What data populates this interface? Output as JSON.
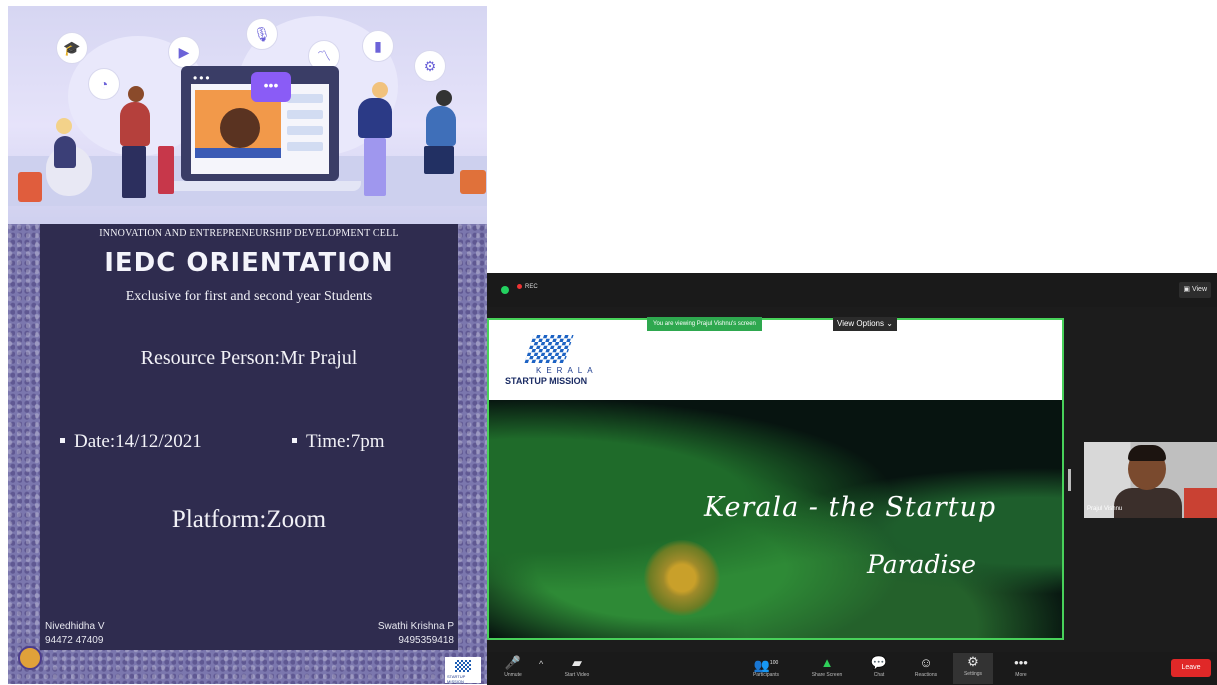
{
  "poster": {
    "header": "INNOVATION AND ENTREPRENEURSHIP DEVELOPMENT CELL",
    "title": "IEDC ORIENTATION",
    "subtitle": "Exclusive for first and second year Students",
    "resource_person": "Resource Person:Mr Prajul",
    "date": "Date:14/12/2021",
    "time": "Time:7pm",
    "platform": "Platform:Zoom",
    "contact_left_name": "Nivedhidha V",
    "contact_left_phone": "94472 47409",
    "contact_right_name": "Swathi Krishna P",
    "contact_right_phone": "9495359418",
    "illustration_icons": [
      "graduation-cap-icon",
      "pie-chart-icon",
      "video-camera-icon",
      "microphone-icon",
      "line-chart-icon",
      "books-icon",
      "gear-icon"
    ]
  },
  "zoom": {
    "recording_label": "REC",
    "view_label": "View",
    "banner": "You are viewing Prajul Vishnu's screen",
    "view_options": "View Options",
    "shared": {
      "kerala": "KERALA",
      "mission": "STARTUP MISSION",
      "script_line1": "Kerala - the Startup",
      "script_line2": "Paradise"
    },
    "participant_name": "Prajul Vishnu",
    "toolbar": {
      "unmute": "Unmute",
      "start_video": "Start Video",
      "participants": "Participants",
      "participants_count": "100",
      "share_screen": "Share Screen",
      "chat": "Chat",
      "reactions": "Reactions",
      "settings": "Settings",
      "more": "More",
      "leave": "Leave"
    },
    "colors": {
      "share_border": "#48d15a",
      "leave": "#e02828"
    }
  }
}
